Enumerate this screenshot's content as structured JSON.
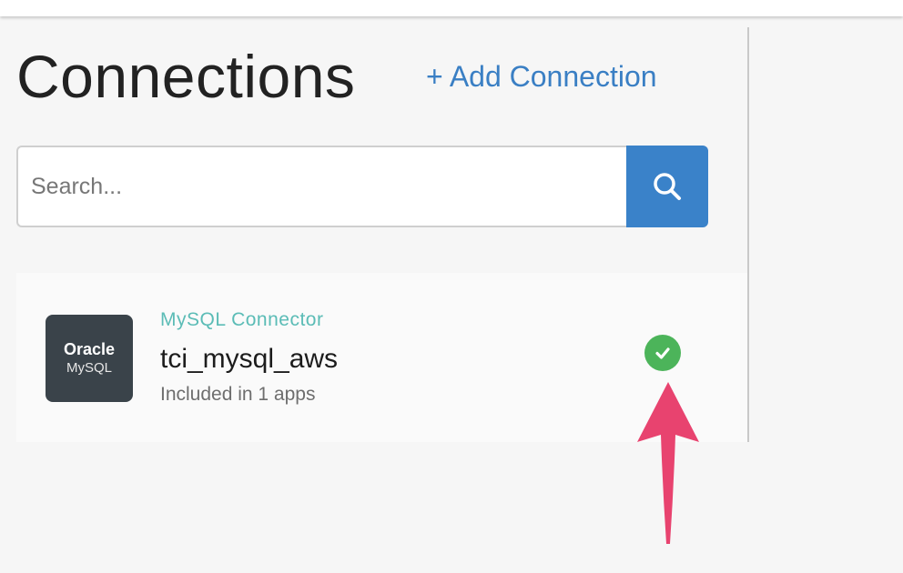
{
  "header": {
    "title": "Connections",
    "add_connection_label": "+ Add Connection"
  },
  "search": {
    "placeholder": "Search...",
    "value": "",
    "button_icon": "search-icon"
  },
  "connections": [
    {
      "logo_line1": "Oracle",
      "logo_line2": "MySQL",
      "connector_type": "MySQL Connector",
      "name": "tci_mysql_aws",
      "usage": "Included in 1 apps",
      "status_icon": "check-circle-icon",
      "status_color": "#4cb45a"
    }
  ],
  "colors": {
    "accent": "#3a7fc4",
    "connector_label": "#5bbcb6",
    "annotation_arrow": "#e8436f"
  }
}
